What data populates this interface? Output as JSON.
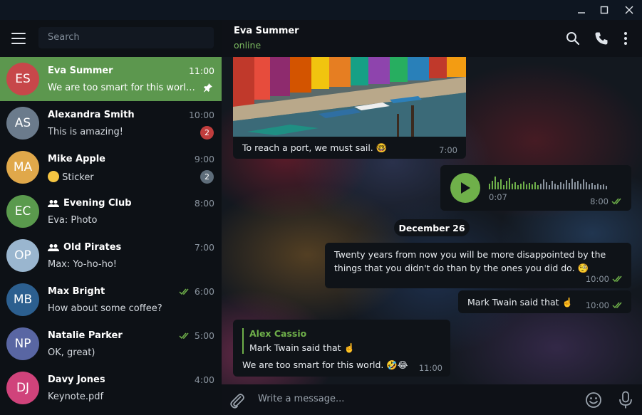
{
  "window": {
    "controls": [
      "minimize",
      "maximize",
      "close"
    ]
  },
  "sidebar": {
    "search_placeholder": "Search",
    "chats": [
      {
        "initials": "ES",
        "name": "Eva Summer",
        "time": "11:00",
        "preview": "We are too smart for this world. 🤣😂",
        "avatar_color": "#c7474a",
        "pinned": true,
        "active": true
      },
      {
        "initials": "AS",
        "name": "Alexandra Smith",
        "time": "10:00",
        "preview": "This is amazing!",
        "avatar_color": "#6b7b8c",
        "badge": "2",
        "badge_color": "#c03d3d"
      },
      {
        "initials": "MA",
        "name": "Mike Apple",
        "time": "9:00",
        "preview": "Sticker",
        "avatar_color": "#e0a84a",
        "badge": "2",
        "badge_color": "#5e6d7a",
        "preview_emoji": true
      },
      {
        "initials": "EC",
        "name": "Evening Club",
        "time": "8:00",
        "preview": "Eva: Photo",
        "avatar_color": "#5a9a4d",
        "group": true
      },
      {
        "initials": "OP",
        "name": "Old Pirates",
        "time": "7:00",
        "preview": "Max: Yo-ho-ho!",
        "avatar_color": "#9ab6cf",
        "group": true
      },
      {
        "initials": "MB",
        "name": "Max Bright",
        "time": "6:00",
        "preview": "How about some coffee?",
        "avatar_color": "#2c5f8f",
        "read": true
      },
      {
        "initials": "NP",
        "name": "Natalie Parker",
        "time": "5:00",
        "preview": "OK, great)",
        "avatar_color": "#5966a3",
        "read": true
      },
      {
        "initials": "DJ",
        "name": "Davy Jones",
        "time": "4:00",
        "preview": "Keynote.pdf",
        "avatar_color": "#d0437b"
      }
    ]
  },
  "chat": {
    "name": "Eva Summer",
    "status": "online",
    "messages": {
      "photo_caption": "To reach a port, we must sail. 🤓",
      "photo_time": "7:00",
      "voice_duration": "0:07",
      "voice_time": "8:00",
      "date": "December 26",
      "quote_line1": "Twenty years from now you will be more disappointed by the",
      "quote_line2": "things that you didn't do than by the ones you did do. 🧐",
      "quote_time": "10:00",
      "twain_text": "Mark Twain said that ☝️",
      "twain_time": "10:00",
      "reply_author": "Alex Cassio",
      "reply_quote": "Mark Twain said that ☝️",
      "reply_text": "We are too smart for this world. 🤣😂",
      "reply_time": "11:00"
    },
    "composer_placeholder": "Write a message..."
  },
  "colors": {
    "accent": "#5c974e",
    "online": "#7ab85f",
    "check": "#6fb04a"
  }
}
